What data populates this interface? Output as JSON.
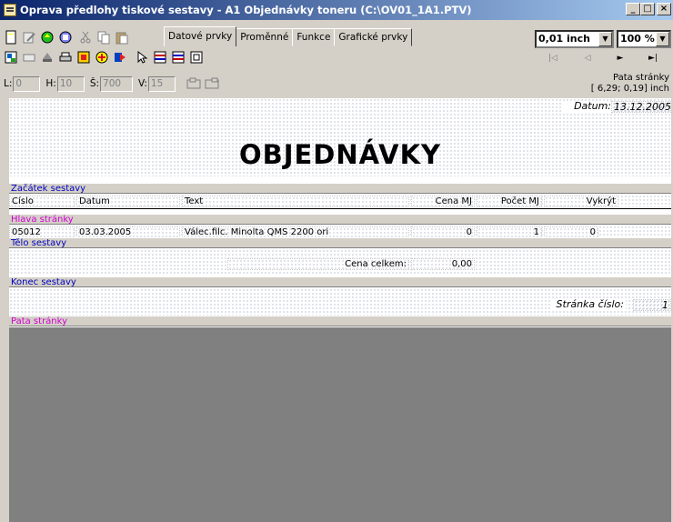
{
  "window": {
    "title": "Oprava předlohy tiskové sestavy - A1 Objednávky toneru (C:\\OV01_1A1.PTV)",
    "buttons": [
      "_",
      "□",
      "×"
    ]
  },
  "toolbar1": {
    "tabs": [
      "Datové prvky",
      "Proměnné",
      "Funkce",
      "Grafické prvky"
    ],
    "unit_select": "0,01 inch",
    "zoom_select": "100 %"
  },
  "toolbar2": {
    "nav_buttons": [
      "|◁",
      "◁",
      "►",
      "►|"
    ]
  },
  "coords": {
    "l_label": "L:",
    "l_value": "0",
    "h_label": "H:",
    "h_value": "10",
    "s_label": "Š:",
    "s_value": "700",
    "v_label": "V:",
    "v_value": "15"
  },
  "footer_info": {
    "line1": "Pata stránky",
    "line2": "[ 6,29; 0,19] inch"
  },
  "report": {
    "date_label": "Datum:",
    "date_value": "13.12.2005",
    "title": "OBJEDNÁVKY",
    "bands": {
      "report_header": "Začátek sestavy",
      "page_header": "Hlava stránky",
      "body": "Tělo sestavy",
      "report_footer": "Konec sestavy",
      "page_footer": "Pata stránky"
    },
    "columns": [
      "Číslo",
      "Datum",
      "Text",
      "Cena MJ",
      "Počet MJ",
      "Vykrýt"
    ],
    "row": [
      "05012",
      "03.03.2005",
      "Válec.filc. Minolta QMS 2200 ori",
      "0",
      "1",
      "0"
    ],
    "total_label": "Cena celkem:",
    "total_value": "0,00",
    "page_label": "Stránka číslo:",
    "page_value": "1"
  },
  "colors": {
    "title_gradient_start": "#0a246a",
    "title_gradient_end": "#a6caf0",
    "band_blue_text": "#0000c0",
    "band_pink_text": "#d000d0",
    "workspace": "#808080"
  },
  "icons": [
    "new-icon",
    "edit-icon",
    "save-icon",
    "save-as-icon",
    "cut-icon",
    "copy-icon",
    "paste-icon",
    "preview-icon",
    "eraser-icon",
    "stamp-icon",
    "print-icon",
    "properties-icon",
    "align-icon",
    "insert-icon",
    "pointer-icon",
    "band-icon",
    "band2-icon",
    "field-icon",
    "mini-toolbar-icon"
  ]
}
